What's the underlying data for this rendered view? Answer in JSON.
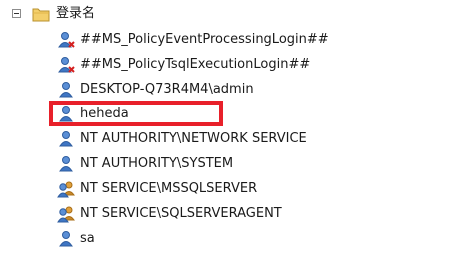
{
  "tree": {
    "root": {
      "label": "登录名",
      "expander_icon": "collapse-minus-icon",
      "folder_icon": "folder-icon"
    },
    "items": [
      {
        "label": "##MS_PolicyEventProcessingLogin##",
        "icon": "disabled-login-icon"
      },
      {
        "label": "##MS_PolicyTsqlExecutionLogin##",
        "icon": "disabled-login-icon"
      },
      {
        "label": "DESKTOP-Q73R4M4\\admin",
        "icon": "user-login-icon"
      },
      {
        "label": "heheda",
        "icon": "user-login-icon"
      },
      {
        "label": "NT AUTHORITY\\NETWORK SERVICE",
        "icon": "user-login-icon"
      },
      {
        "label": "NT AUTHORITY\\SYSTEM",
        "icon": "user-login-icon"
      },
      {
        "label": "NT SERVICE\\MSSQLSERVER",
        "icon": "group-login-icon"
      },
      {
        "label": "NT SERVICE\\SQLSERVERAGENT",
        "icon": "group-login-icon"
      },
      {
        "label": "sa",
        "icon": "user-login-icon"
      }
    ]
  },
  "annotation": {
    "color": "#e8202a"
  }
}
